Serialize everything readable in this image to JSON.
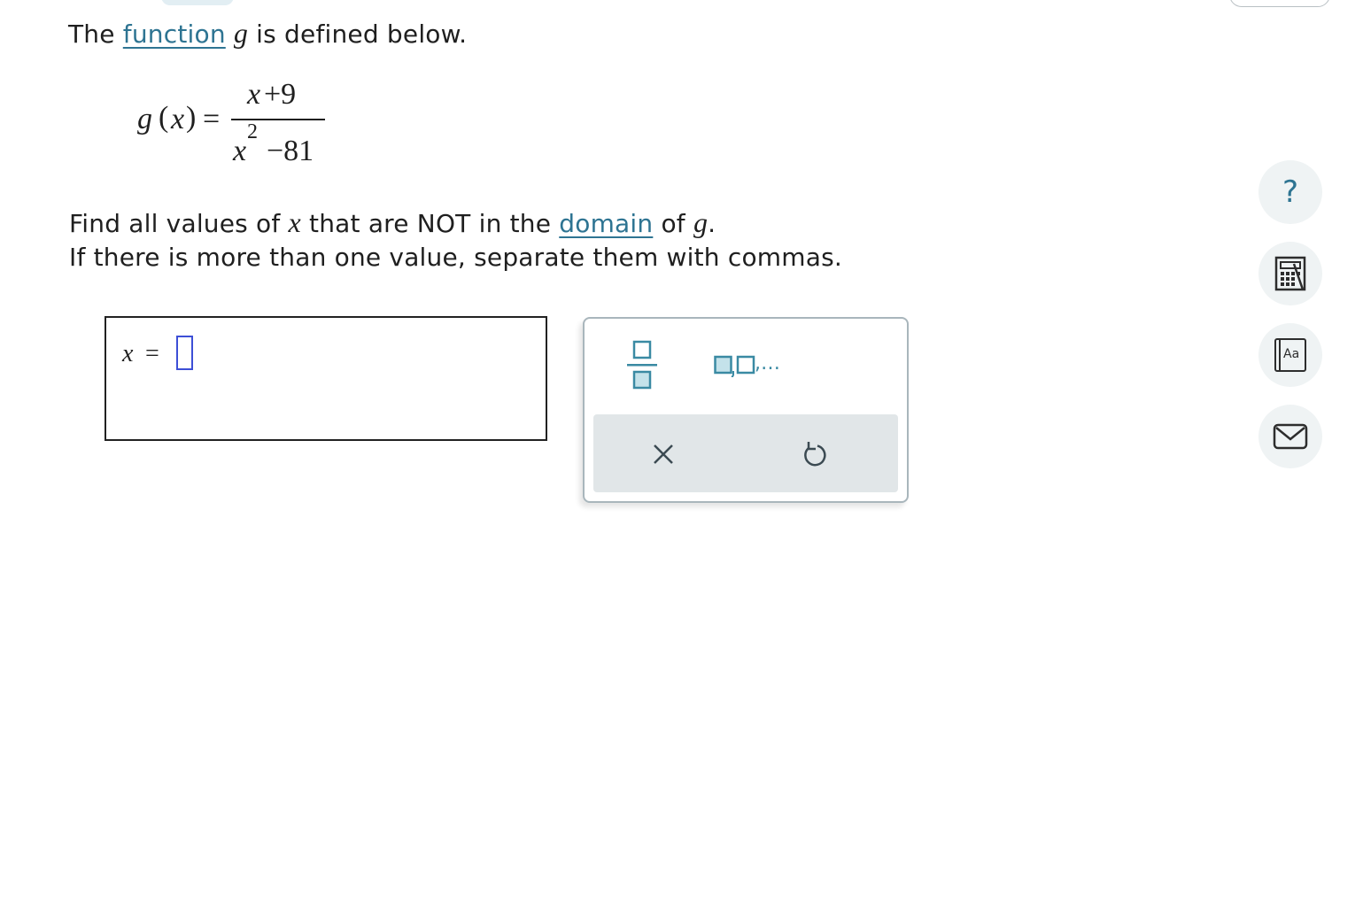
{
  "top_tab": {},
  "intro": {
    "prefix": "The ",
    "function_link": "function",
    "var": "g",
    "suffix": " is defined below."
  },
  "formula": {
    "lhs_name": "g",
    "lhs_open": "(",
    "lhs_var": "x",
    "lhs_close": ")",
    "equals": "=",
    "numerator_var": "x",
    "numerator_rest": "+9",
    "denominator_var": "x",
    "denominator_exponent": "2",
    "denominator_rest": "−81"
  },
  "question": {
    "line1_prefix": "Find all values of ",
    "line1_var": "x",
    "line1_middle": " that are NOT in the ",
    "domain_link": "domain",
    "line1_of": " of ",
    "line1_g": "g",
    "line1_end": ".",
    "line2": "If there is more than one value, separate them with commas."
  },
  "answer": {
    "var": "x",
    "equals": "="
  },
  "keypad": {
    "list_ellipsis": ",…"
  },
  "sidebar": {
    "help_label": "?",
    "glossary_label": "Aa"
  },
  "colors": {
    "link": "#2e7492",
    "keypad_icon": "#3a8aa3",
    "cursor": "#3d4fd6",
    "side_bg": "#eff3f4"
  }
}
